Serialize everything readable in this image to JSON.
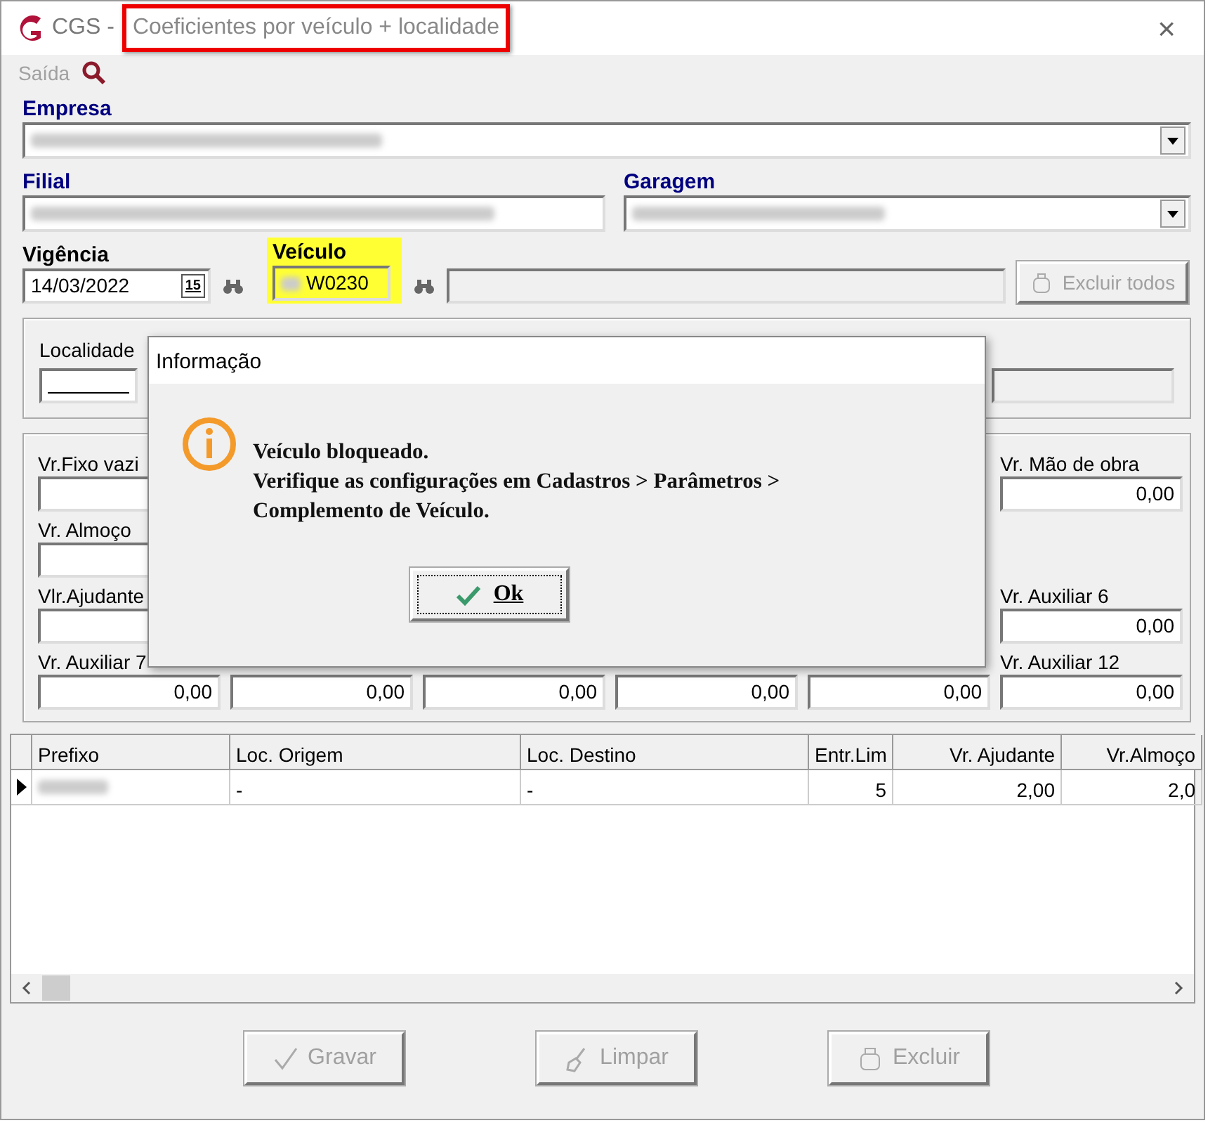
{
  "window": {
    "app": "CGS -",
    "title": "Coeficientes por veículo + localidade",
    "outlined": true,
    "close": "×"
  },
  "toolbar": {
    "exit": {
      "label": "Saída",
      "disabled": true
    }
  },
  "empresa": {
    "label": "Empresa"
  },
  "filial": {
    "label": "Filial"
  },
  "garagem": {
    "label": "Garagem"
  },
  "vigencia": {
    "label": "Vigência",
    "value": "14/03/2022",
    "calendar": "15"
  },
  "veiculo": {
    "label": "Veículo",
    "value": "W0230",
    "highlighted": true
  },
  "excluir_todos": {
    "label": "Excluir todos",
    "disabled": true
  },
  "localidade": {
    "label": "Localidade"
  },
  "values": [
    [
      {
        "kind": "field",
        "label": "Vr.Fixo vazi"
      },
      {
        "kind": "blank"
      },
      {
        "kind": "blank"
      },
      {
        "kind": "blank"
      },
      {
        "kind": "blank"
      },
      {
        "kind": "field",
        "label": "Vr. Mão de obra",
        "value": "0,00"
      }
    ],
    [
      {
        "kind": "field",
        "label": "Vr. Almoço"
      },
      {
        "kind": "blank"
      },
      {
        "kind": "blank"
      },
      {
        "kind": "blank"
      },
      {
        "kind": "blank"
      },
      {
        "kind": "blank"
      }
    ],
    [
      {
        "kind": "field",
        "label": "Vlr.Ajudante"
      },
      {
        "kind": "blank"
      },
      {
        "kind": "blank"
      },
      {
        "kind": "blank"
      },
      {
        "kind": "blank"
      },
      {
        "kind": "field",
        "label": "Vr. Auxiliar 6",
        "value": "0,00"
      }
    ],
    [
      {
        "kind": "field",
        "label": "Vr. Auxiliar 7",
        "value": "0,00"
      },
      {
        "kind": "field",
        "value": "0,00"
      },
      {
        "kind": "field",
        "value": "0,00"
      },
      {
        "kind": "field",
        "value": "0,00"
      },
      {
        "kind": "field",
        "value": "0,00"
      },
      {
        "kind": "field",
        "label": "Vr. Auxiliar 12",
        "value": "0,00"
      }
    ]
  ],
  "table": {
    "columns": [
      {
        "label": "Prefixo"
      },
      {
        "label": "Loc. Origem"
      },
      {
        "label": "Loc. Destino"
      },
      {
        "label": "Entr.Lim"
      },
      {
        "label": "Vr. Ajudante"
      },
      {
        "label": "Vr.Almoço"
      }
    ],
    "rows": [
      {
        "selected": true,
        "cells": [
          "",
          "-",
          "-",
          "5",
          "2,00",
          "2,0"
        ]
      }
    ]
  },
  "buttons": [
    {
      "label": "Gravar",
      "disabled": true
    },
    {
      "label": "Limpar",
      "disabled": true
    },
    {
      "label": "Excluir",
      "disabled": true
    }
  ],
  "dialog": {
    "title": "Informação",
    "lines": [
      "Veículo bloqueado.",
      "Verifique as configurações em Cadastros > Parâmetros >",
      "Complemento de Veículo."
    ],
    "button": "Ok"
  }
}
